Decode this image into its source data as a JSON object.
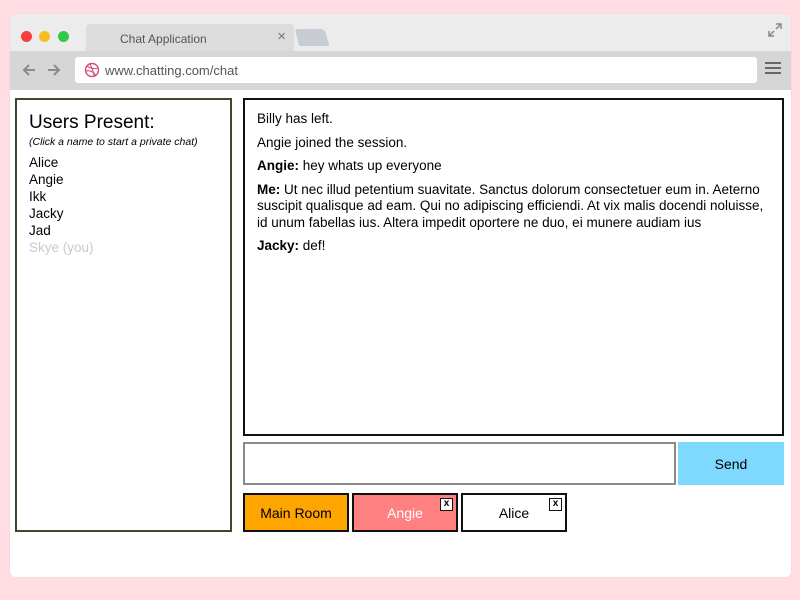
{
  "browser": {
    "tab_title": "Chat Application",
    "tab_close": "×",
    "url": "www.chatting.com/chat"
  },
  "users": {
    "title": "Users Present:",
    "hint": "(Click a name to start a private chat)",
    "list": [
      "Alice",
      "Angie",
      "Ikk",
      "Jacky",
      "Jad"
    ],
    "self": "Skye (you)"
  },
  "chat": {
    "messages": [
      {
        "sender": "",
        "text": "Billy has left."
      },
      {
        "sender": "",
        "text": "Angie joined the session."
      },
      {
        "sender": "Angie:",
        "text": " hey whats up everyone"
      },
      {
        "sender": "Me:",
        "text": " Ut nec illud petentium suavitate. Sanctus dolorum consectetuer eum in. Aeterno suscipit qualisque ad eam. Qui no adipiscing efficiendi. At vix malis docendi noluisse, id unum fabellas ius. Altera impedit oportere ne duo, ei munere audiam ius"
      },
      {
        "sender": "Jacky:",
        "text": " def!"
      }
    ]
  },
  "composer": {
    "input_value": "",
    "input_placeholder": "",
    "send_label": "Send"
  },
  "rooms": {
    "main_label": "Main Room",
    "angie_label": "Angie",
    "alice_label": "Alice",
    "close_glyph": "x"
  },
  "colors": {
    "page_bg": "#ffdde2",
    "send_button": "#7fd9ff",
    "main_room_tab": "#ffa500",
    "angie_tab": "#ff8080",
    "self_user": "#c9c9c9"
  },
  "icons": {
    "back": "arrow-left-icon",
    "forward": "arrow-right-icon",
    "site": "dribbble-icon",
    "menu": "hamburger-menu-icon",
    "expand": "expand-icon"
  }
}
